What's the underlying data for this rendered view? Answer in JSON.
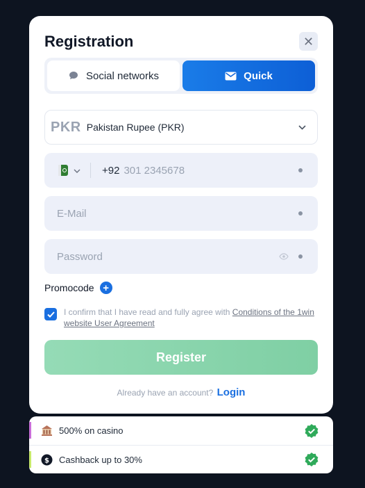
{
  "modal": {
    "title": "Registration",
    "close_icon": "close-icon"
  },
  "tabs": [
    {
      "label": "Social networks",
      "icon": "chat-icon",
      "active": false
    },
    {
      "label": "Quick",
      "icon": "envelope-icon",
      "active": true
    }
  ],
  "currency": {
    "code": "PKR",
    "name": "Pakistan Rupee (PKR)"
  },
  "phone": {
    "country_code": "+92",
    "placeholder": "301 2345678",
    "flag": "pakistan-flag-icon"
  },
  "email": {
    "placeholder": "E-Mail"
  },
  "password": {
    "placeholder": "Password"
  },
  "promocode": {
    "label": "Promocode"
  },
  "agreement": {
    "checked": true,
    "text": "I confirm that I have read and fully agree with ",
    "link": "Conditions of the 1win website User Agreement"
  },
  "register_label": "Register",
  "login": {
    "prompt": "Already have an account?",
    "link": "Login"
  },
  "bonuses": [
    {
      "text": "500% on casino",
      "icon": "casino-icon",
      "accent": "#c86dd7"
    },
    {
      "text": "Cashback up to 30%",
      "icon": "cashback-icon",
      "accent": "#c6e86a"
    }
  ],
  "colors": {
    "primary": "#1a6fe0",
    "register_button": "#8fd7b0",
    "badge_green": "#2faa5a"
  }
}
